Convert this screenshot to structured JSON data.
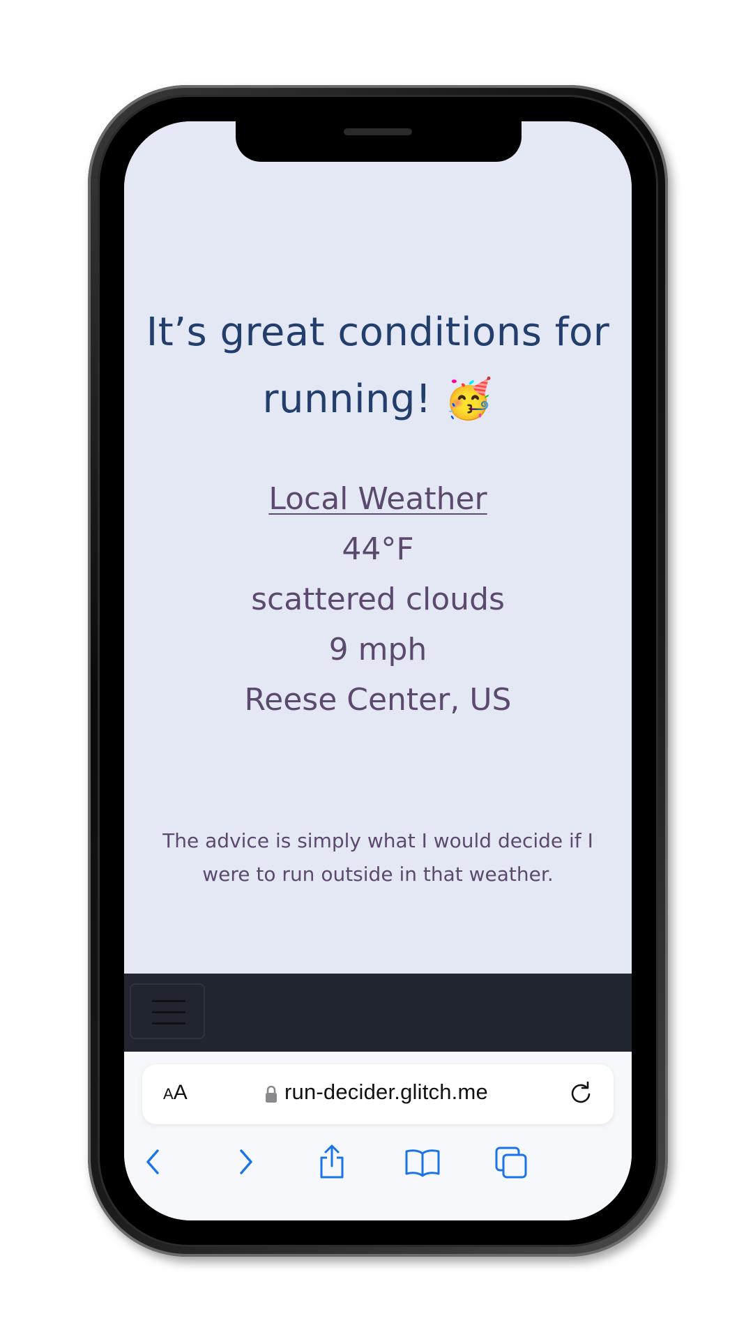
{
  "page": {
    "headline": "It’s great conditions for running!",
    "headline_emoji": "🥳",
    "weather_link": "Local Weather",
    "temperature": "44°F",
    "conditions": "scattered clouds",
    "wind": "9 mph",
    "location": "Reese Center, US",
    "advice": "The advice is simply what I would decide if I were to run outside in that weather."
  },
  "browser": {
    "text_size_small": "A",
    "text_size_big": "A",
    "url": "run-decider.glitch.me"
  },
  "icons": {
    "lock": "lock-icon",
    "reload": "reload-icon",
    "back": "chevron-left-icon",
    "forward": "chevron-right-icon",
    "share": "share-icon",
    "bookmarks": "book-icon",
    "tabs": "tabs-icon",
    "menu": "hamburger-icon"
  },
  "colors": {
    "page_background": "#e4e7f4",
    "headline": "#223e6c",
    "body_text": "#5b4a6e",
    "navbar": "#21252f",
    "ios_blue": "#1a73e8"
  }
}
